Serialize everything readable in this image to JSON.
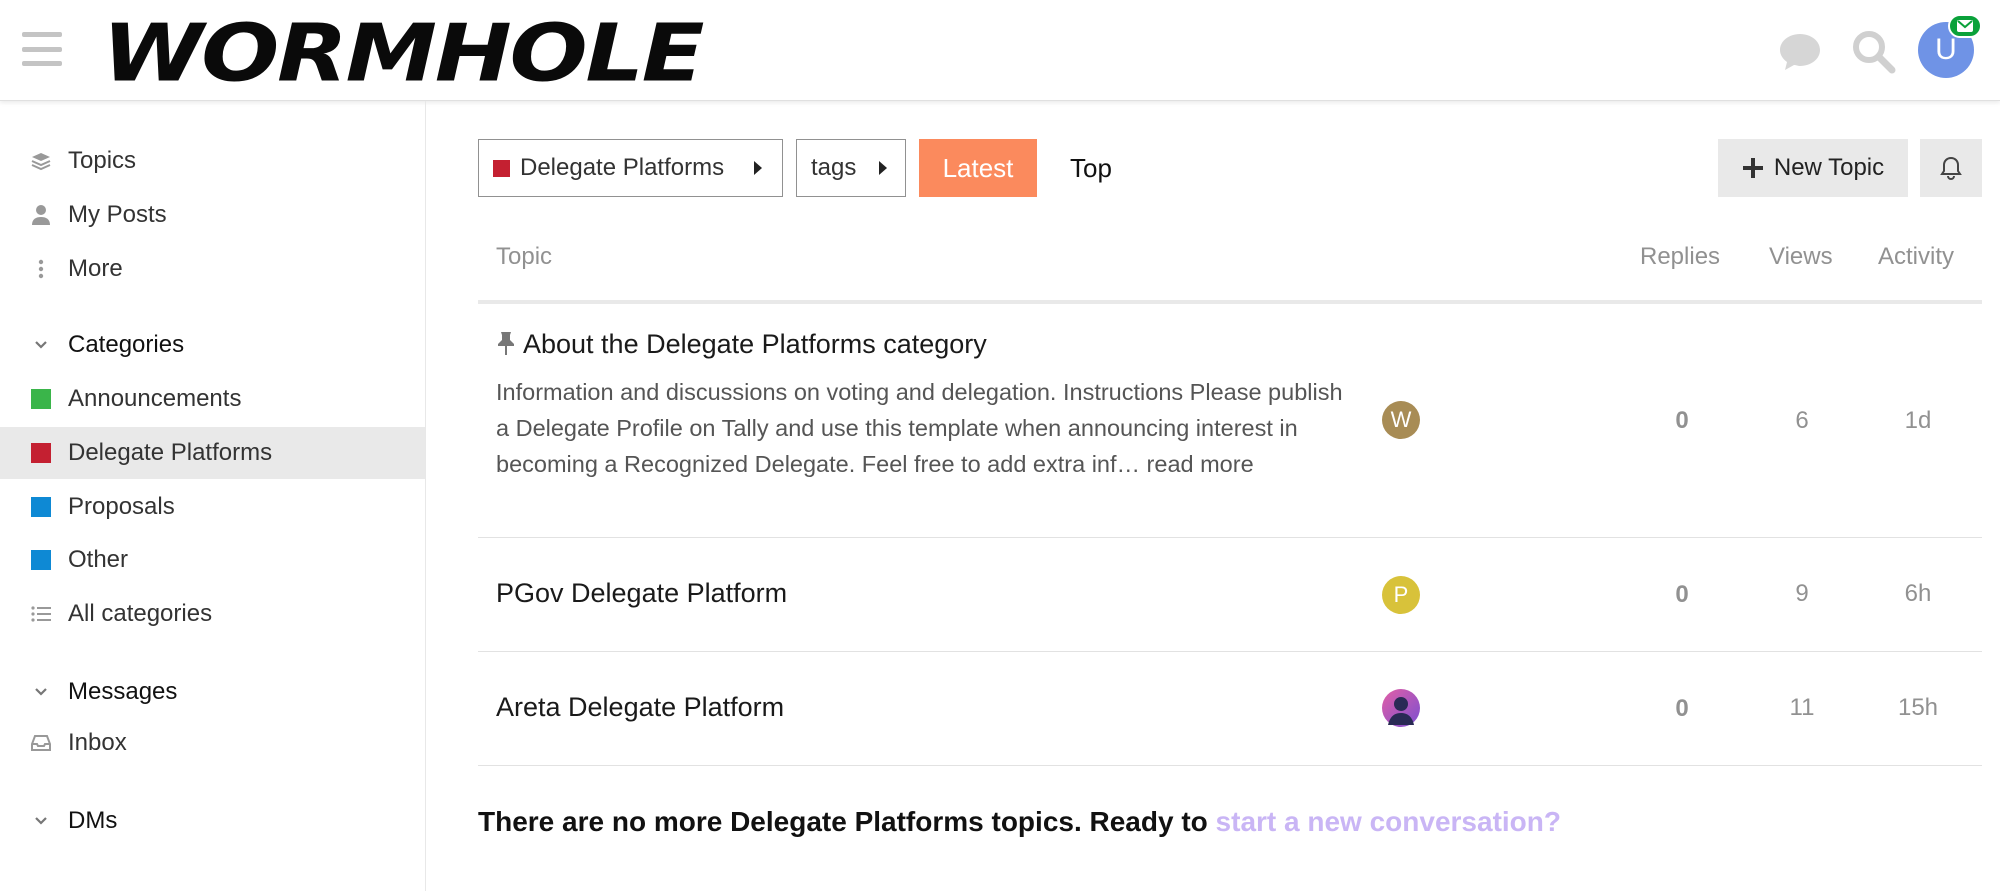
{
  "header": {
    "logo_text": "WORMHOLE",
    "avatar_letter": "U"
  },
  "sidebar": {
    "nav": [
      {
        "label": "Topics",
        "icon": "layers-icon"
      },
      {
        "label": "My Posts",
        "icon": "user-icon"
      },
      {
        "label": "More",
        "icon": "vertical-ellipsis-icon"
      }
    ],
    "categories_heading": "Categories",
    "categories": [
      {
        "label": "Announcements",
        "color": "#3ab54a"
      },
      {
        "label": "Delegate Platforms",
        "color": "#c42031",
        "active": true
      },
      {
        "label": "Proposals",
        "color": "#0e89d4"
      },
      {
        "label": "Other",
        "color": "#0e89d4"
      }
    ],
    "all_categories": "All categories",
    "messages_heading": "Messages",
    "inbox": "Inbox",
    "dms_heading": "DMs"
  },
  "toolbar": {
    "category_dropdown": "Delegate Platforms",
    "category_color": "#c42031",
    "tags_dropdown": "tags",
    "latest": "Latest",
    "top": "Top",
    "new_topic": "New Topic"
  },
  "table": {
    "columns": {
      "topic": "Topic",
      "replies": "Replies",
      "views": "Views",
      "activity": "Activity"
    },
    "rows": [
      {
        "title": "About the Delegate Platforms category",
        "pinned": true,
        "excerpt": "Information and discussions on voting and delegation. Instructions Please publish a Delegate Profile on Tally and use this template when announcing interest in becoming a Recognized Delegate. Feel free to add extra inf…",
        "read_more": "read more",
        "poster_letter": "W",
        "poster_color": "#a88c55",
        "replies": "0",
        "views": "6",
        "activity": "1d"
      },
      {
        "title": "PGov Delegate Platform",
        "poster_letter": "P",
        "poster_color": "#d8c23a",
        "replies": "0",
        "views": "9",
        "activity": "6h"
      },
      {
        "title": "Areta Delegate Platform",
        "poster_letter": "",
        "poster_color": "#c94fa8",
        "replies": "0",
        "views": "11",
        "activity": "15h"
      }
    ]
  },
  "footer": {
    "message": "There are no more Delegate Platforms topics. Ready to",
    "link": "start a new conversation?"
  },
  "colors": {
    "accent_latest": "#fb8a5d",
    "link_lavender": "#c9b5f5",
    "mail_badge": "#0aa13a",
    "avatar_user": "#6f93e6"
  }
}
